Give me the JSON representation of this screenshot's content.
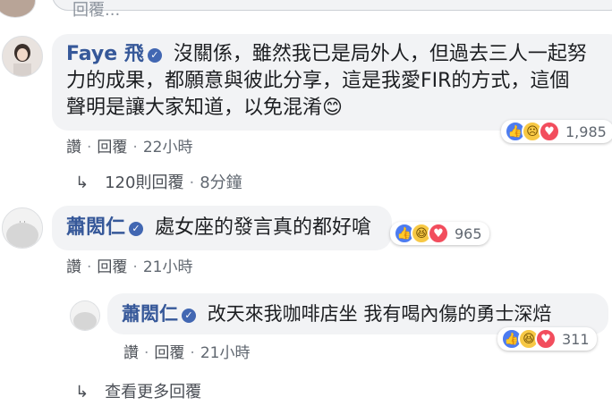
{
  "top": {
    "input_placeholder": "回覆..."
  },
  "comments": [
    {
      "author": "Faye 飛",
      "lines": [
        "沒關係，雖然我已是局外人，但過去三人一起努",
        "力的成果，都願意與彼此分享，這是我愛FIR的方式，這個",
        "聲明是讓大家知道，以免混淆"
      ],
      "emoji": "😊",
      "reactions": [
        "like",
        "sad",
        "love"
      ],
      "reaction_count": "1,985",
      "actions": {
        "like": "讚",
        "reply": "回覆",
        "time": "22小時"
      }
    },
    {
      "author": "蕭閎仁",
      "text": "處女座的發言真的都好嗆",
      "reactions": [
        "like",
        "haha",
        "love"
      ],
      "reaction_count": "965",
      "actions": {
        "like": "讚",
        "reply": "回覆",
        "time": "21小時"
      }
    },
    {
      "author": "蕭閎仁",
      "text": "改天來我咖啡店坐 我有喝內傷的勇士深焙",
      "reactions": [
        "like",
        "haha",
        "love"
      ],
      "reaction_count": "311",
      "actions": {
        "like": "讚",
        "reply": "回覆",
        "time": "21小時"
      }
    }
  ],
  "replies_link": {
    "text": "120則回覆",
    "time": "8分鐘"
  },
  "more_replies": {
    "text": "查看更多回覆"
  },
  "colors": {
    "name": "#365899",
    "bubble": "#f2f3f5",
    "like": "#4d7cf0",
    "love": "#f24d5d"
  }
}
